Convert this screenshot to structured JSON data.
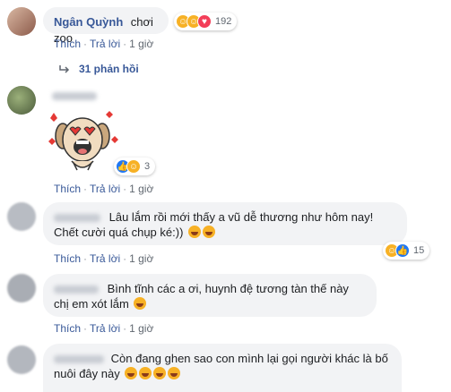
{
  "comments": [
    {
      "name": "Ngân Quỳnh",
      "text": "chơi zoo",
      "reactions": [
        "haha",
        "haha",
        "heart"
      ],
      "reaction_count": "192",
      "actions": {
        "like": "Thích",
        "reply": "Trả lời",
        "time": "1 giờ"
      }
    },
    {
      "replies_label": "31 phản hồi"
    },
    {
      "reactions": [
        "like",
        "haha"
      ],
      "reaction_count": "3",
      "actions": {
        "like": "Thích",
        "reply": "Trả lời",
        "time": "1 giờ"
      }
    },
    {
      "text": "Lâu lắm rồi mới thấy a vũ dễ thương như hôm nay! Chết cười quá chụp ké:))",
      "reactions": [
        "haha",
        "like"
      ],
      "reaction_count": "15",
      "actions": {
        "like": "Thích",
        "reply": "Trả lời",
        "time": "1 giờ"
      }
    },
    {
      "text": "Bình tĩnh các a ơi, huynh đệ tương tàn thế này chị em xót lắm",
      "actions": {
        "like": "Thích",
        "reply": "Trả lời",
        "time": "1 giờ"
      }
    },
    {
      "text": "Còn đang ghen sao con mình lại gọi người khác là bố nuôi đây này"
    }
  ],
  "colors": {
    "link": "#385898",
    "bubble": "#f2f3f5",
    "like": "#2078f4",
    "haha": "#f7b125",
    "heart": "#f33e58"
  }
}
